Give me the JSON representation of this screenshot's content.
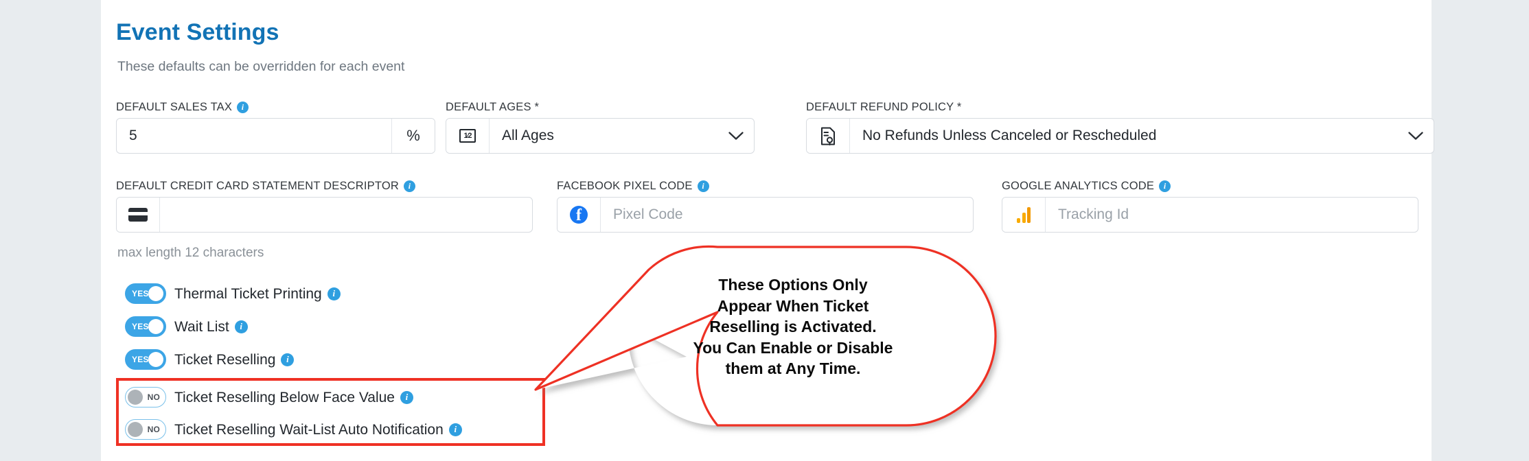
{
  "header": {
    "title": "Event Settings",
    "subtitle": "These defaults can be overridden for each event"
  },
  "colors": {
    "title_blue": "#1273b5",
    "toggle_on_blue": "#3ca5e6",
    "toggle_off_border": "#79c0ea",
    "info_icon_blue": "#2f9fe0",
    "highlight_red": "#ef3124",
    "page_background": "#e8ecef",
    "card_background": "#ffffff"
  },
  "fields": {
    "sales_tax": {
      "label": "DEFAULT SALES TAX",
      "has_info": true,
      "value": "5",
      "suffix": "%"
    },
    "ages": {
      "label": "DEFAULT AGES *",
      "has_info": false,
      "value": "All Ages",
      "icon": "age-badge-icon",
      "icon_text": "1⁄2"
    },
    "refund_policy": {
      "label": "DEFAULT REFUND POLICY *",
      "has_info": false,
      "value": "No Refunds Unless Canceled or Rescheduled",
      "icon": "refund-document-icon"
    },
    "statement_descriptor": {
      "label": "DEFAULT CREDIT CARD STATEMENT DESCRIPTOR",
      "has_info": true,
      "value": "",
      "placeholder": "",
      "icon": "credit-card-icon",
      "helper": "max length 12 characters"
    },
    "facebook_pixel": {
      "label": "FACEBOOK PIXEL CODE",
      "has_info": true,
      "value": "",
      "placeholder": "Pixel Code",
      "icon": "facebook-icon"
    },
    "google_analytics": {
      "label": "GOOGLE ANALYTICS CODE",
      "has_info": true,
      "value": "",
      "placeholder": "Tracking Id",
      "icon": "google-analytics-icon"
    }
  },
  "toggles": [
    {
      "label": "Thermal Ticket Printing",
      "state": "YES",
      "on": true,
      "has_info": true,
      "highlighted": false
    },
    {
      "label": "Wait List",
      "state": "YES",
      "on": true,
      "has_info": true,
      "highlighted": false
    },
    {
      "label": "Ticket Reselling",
      "state": "YES",
      "on": true,
      "has_info": true,
      "highlighted": false
    },
    {
      "label": "Ticket Reselling Below Face Value",
      "state": "NO",
      "on": false,
      "has_info": true,
      "highlighted": true
    },
    {
      "label": "Ticket Reselling Wait-List Auto Notification",
      "state": "NO",
      "on": false,
      "has_info": true,
      "highlighted": true
    }
  ],
  "callout": {
    "line1": "These Options Only",
    "line2": "Appear When Ticket",
    "line3": "Reselling is Activated.",
    "line4": "You Can Enable or Disable",
    "line5": "them at Any Time."
  }
}
